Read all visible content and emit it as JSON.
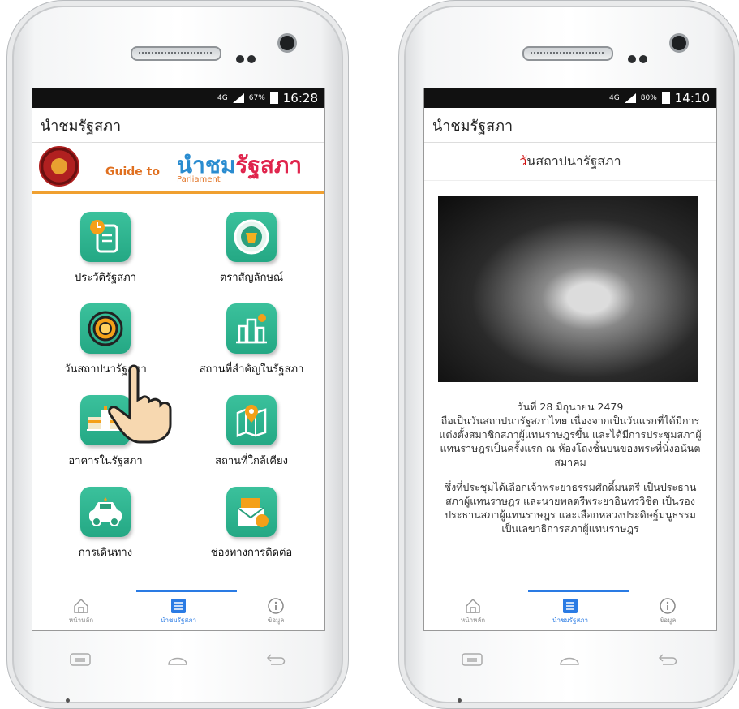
{
  "left": {
    "status": {
      "network": "4G",
      "battery": "67%",
      "time": "16:28"
    },
    "app_title": "นำชมรัฐสภา",
    "banner": {
      "guide": "Guide to",
      "logo_a": "นำชม",
      "logo_b": "รัฐสภา",
      "sub": "Parliament"
    },
    "tiles": [
      {
        "label": "ประวัติรัฐสภา",
        "icon": "document-clock-icon"
      },
      {
        "label": "ตราสัญลักษณ์",
        "icon": "parliament-seal-icon"
      },
      {
        "label": "วันสถาปนารัฐสภา",
        "icon": "touch-icon"
      },
      {
        "label": "สถานที่สำคัญในรัฐสภา",
        "icon": "city-location-icon"
      },
      {
        "label": "อาคารในรัฐสภา",
        "icon": "building-icon"
      },
      {
        "label": "สถานที่ใกล้เคียง",
        "icon": "map-pin-icon"
      },
      {
        "label": "การเดินทาง",
        "icon": "taxi-icon"
      },
      {
        "label": "ช่องทางการติดต่อ",
        "icon": "mail-phone-icon"
      }
    ],
    "nav": {
      "home": "หน้าหลัก",
      "guide": "นำชมรัฐสภา",
      "info": "ข้อมูล"
    }
  },
  "right": {
    "status": {
      "network": "4G",
      "battery": "80%",
      "time": "14:10"
    },
    "app_title": "นำชมรัฐสภา",
    "page_title_first": "วั",
    "page_title_rest": "นสถาปนารัฐสภา",
    "article": {
      "date": "วันที่ 28 มิถุนายน 2479",
      "p1": "ถือเป็นวันสถาปนารัฐสภาไทย เนื่องจากเป็นวันแรกที่ได้มีการแต่งตั้งสมาชิกสภาผู้แทนราษฎรขึ้น และได้มีการประชุมสภาผู้แทนราษฎรเป็นครั้งแรก ณ ห้องโถงชั้นบนของพระที่นั่งอนันตสมาคม",
      "p2": "ซึ่งที่ประชุมได้เลือกเจ้าพระยาธรรมศักดิ์มนตรี เป็นประธานสภาผู้แทนราษฎร และนายพลตรีพระยาอินทรวิชิต เป็นรองประธานสภาผู้แทนราษฎร และเลือกหลวงประดิษฐ์มนูธรรม เป็นเลขาธิการสภาผู้แทนราษฎร"
    },
    "nav": {
      "home": "หน้าหลัก",
      "guide": "นำชมรัฐสภา",
      "info": "ข้อมูล"
    }
  },
  "colors": {
    "accent": "#2a7be4",
    "tile": "#2db590",
    "banner_orange": "#f0a030"
  }
}
